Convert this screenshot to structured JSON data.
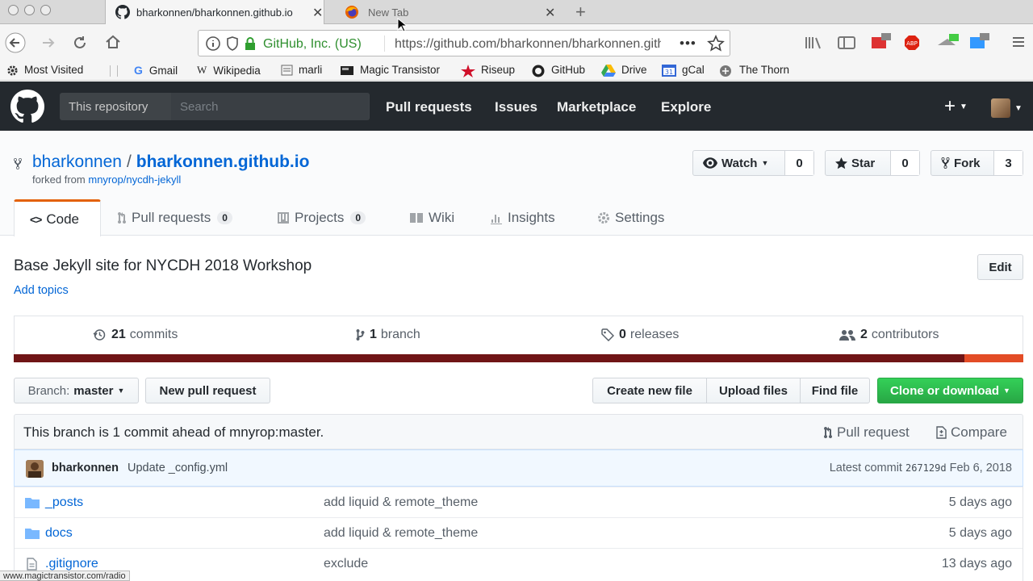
{
  "browser": {
    "tabs": [
      {
        "title": "bharkonnen/bharkonnen.github.io",
        "active": true
      },
      {
        "title": "New Tab",
        "active": false
      }
    ],
    "url_site": "GitHub, Inc. (US)",
    "url": "https://github.com/bharkonnen/bharkonnen.github.io",
    "bookmarks": [
      "Most Visited",
      "Gmail",
      "Wikipedia",
      "marli",
      "Magic Transistor",
      "Riseup",
      "GitHub",
      "Drive",
      "gCal",
      "The Thorn"
    ],
    "status_url": "www.magictransistor.com/radio"
  },
  "github_header": {
    "scope": "This repository",
    "search_placeholder": "Search",
    "nav": [
      "Pull requests",
      "Issues",
      "Marketplace",
      "Explore"
    ],
    "plus": "+"
  },
  "repo": {
    "owner": "bharkonnen",
    "separator": "/",
    "name": "bharkonnen.github.io",
    "forked_prefix": "forked from",
    "forked_from": "mnyrop/nycdh-jekyll",
    "watch": {
      "label": "Watch",
      "count": "0"
    },
    "star": {
      "label": "Star",
      "count": "0"
    },
    "fork": {
      "label": "Fork",
      "count": "3"
    },
    "tabs": [
      {
        "label": "Code",
        "count": ""
      },
      {
        "label": "Pull requests",
        "count": "0"
      },
      {
        "label": "Projects",
        "count": "0"
      },
      {
        "label": "Wiki",
        "count": ""
      },
      {
        "label": "Insights",
        "count": ""
      },
      {
        "label": "Settings",
        "count": ""
      }
    ],
    "code_glyph": "<>",
    "description": "Base Jekyll site for NYCDH 2018 Workshop",
    "add_topics": "Add topics",
    "edit": "Edit"
  },
  "summary": {
    "commits": {
      "count": "21",
      "label": "commits"
    },
    "branches": {
      "count": "1",
      "label": "branch"
    },
    "releases": {
      "count": "0",
      "label": "releases"
    },
    "contributors": {
      "count": "2",
      "label": "contributors"
    },
    "languages": [
      {
        "color": "#701516",
        "share": 0.942
      },
      {
        "color": "#e34c26",
        "share": 0.058
      }
    ]
  },
  "toolbar": {
    "branch_prefix": "Branch:",
    "branch": "master",
    "new_pr": "New pull request",
    "create_file": "Create new file",
    "upload": "Upload files",
    "find": "Find file",
    "clone": "Clone or download"
  },
  "ahead": {
    "text": "This branch is 1 commit ahead of mnyrop:master.",
    "pull_request": "Pull request",
    "compare": "Compare"
  },
  "latest_commit": {
    "author": "bharkonnen",
    "message": "Update _config.yml",
    "prefix": "Latest commit",
    "sha": "267129d",
    "date": "Feb 6, 2018"
  },
  "files": [
    {
      "name": "_posts",
      "type": "dir",
      "message": "add liquid & remote_theme",
      "age": "5 days ago"
    },
    {
      "name": "docs",
      "type": "dir",
      "message": "add liquid & remote_theme",
      "age": "5 days ago"
    },
    {
      "name": ".gitignore",
      "type": "file",
      "message": "exclude",
      "age": "13 days ago"
    }
  ]
}
